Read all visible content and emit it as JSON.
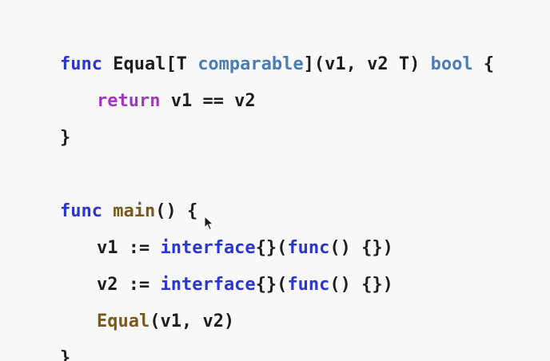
{
  "lines": [
    {
      "tokens": [
        {
          "text": "func",
          "kind": "kw"
        },
        {
          "text": " Equal[T ",
          "kind": "plain"
        },
        {
          "text": "comparable",
          "kind": "type"
        },
        {
          "text": "](v1, v2 T) ",
          "kind": "plain"
        },
        {
          "text": "bool",
          "kind": "type"
        },
        {
          "text": " {",
          "kind": "plain"
        }
      ]
    },
    {
      "tokens": [
        {
          "text": "return",
          "kind": "ctrl"
        },
        {
          "text": " v1 == v2",
          "kind": "plain"
        }
      ]
    },
    {
      "tokens": [
        {
          "text": "}",
          "kind": "plain"
        }
      ]
    },
    {
      "tokens": [
        {
          "text": "func",
          "kind": "kw"
        },
        {
          "text": " ",
          "kind": "plain"
        },
        {
          "text": "main",
          "kind": "fn"
        },
        {
          "text": "() {",
          "kind": "plain"
        }
      ]
    },
    {
      "tokens": [
        {
          "text": "v1 := ",
          "kind": "plain"
        },
        {
          "text": "interface",
          "kind": "kw"
        },
        {
          "text": "{}(",
          "kind": "plain"
        },
        {
          "text": "func",
          "kind": "kw"
        },
        {
          "text": "() {})",
          "kind": "plain"
        }
      ]
    },
    {
      "tokens": [
        {
          "text": "v2 := ",
          "kind": "plain"
        },
        {
          "text": "interface",
          "kind": "kw"
        },
        {
          "text": "{}(",
          "kind": "plain"
        },
        {
          "text": "func",
          "kind": "kw"
        },
        {
          "text": "() {})",
          "kind": "plain"
        }
      ]
    },
    {
      "tokens": [
        {
          "text": "Equal",
          "kind": "fn"
        },
        {
          "text": "(v1, v2)",
          "kind": "plain"
        }
      ]
    },
    {
      "tokens": [
        {
          "text": "}",
          "kind": "plain"
        }
      ]
    }
  ],
  "colors": {
    "background": "#f8f8f8",
    "keyword": "#2b36d0",
    "control": "#a435c2",
    "type": "#4a7db4",
    "function": "#7a5a1c",
    "text": "#1e1e1e"
  },
  "cursor_icon": "mouse-pointer-icon"
}
